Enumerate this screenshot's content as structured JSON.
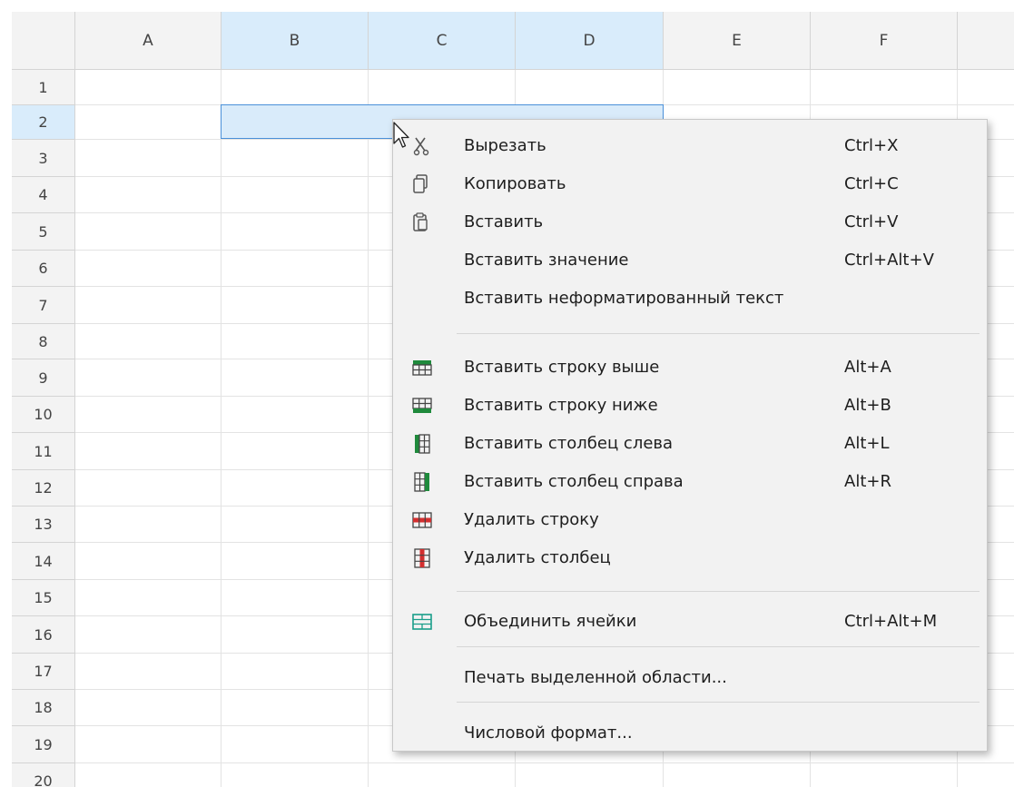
{
  "sheet": {
    "columns": [
      "A",
      "B",
      "C",
      "D",
      "E",
      "F"
    ],
    "selected_columns": [
      "B",
      "C",
      "D"
    ],
    "rows": [
      "1",
      "2",
      "3",
      "4",
      "5",
      "6",
      "7",
      "8",
      "9",
      "10",
      "11",
      "12",
      "13",
      "14",
      "15",
      "16",
      "17",
      "18",
      "19",
      "20"
    ],
    "selected_row": "2",
    "selection_color": "#d9ebfa",
    "selection_border_color": "#4a90d9"
  },
  "context_menu": {
    "items": [
      {
        "label": "Вырезать",
        "shortcut": "Ctrl+X",
        "icon": "scissors-icon"
      },
      {
        "label": "Копировать",
        "shortcut": "Ctrl+C",
        "icon": "copy-icon"
      },
      {
        "label": "Вставить",
        "shortcut": "Ctrl+V",
        "icon": "paste-icon"
      },
      {
        "label": "Вставить значение",
        "shortcut": "Ctrl+Alt+V",
        "icon": ""
      },
      {
        "label": "Вставить неформатированный текст",
        "shortcut": "",
        "icon": ""
      },
      {
        "label": "Вставить строку выше",
        "shortcut": "Alt+A",
        "icon": "insert-row-above-icon"
      },
      {
        "label": "Вставить строку ниже",
        "shortcut": "Alt+B",
        "icon": "insert-row-below-icon"
      },
      {
        "label": "Вставить столбец слева",
        "shortcut": "Alt+L",
        "icon": "insert-column-left-icon"
      },
      {
        "label": "Вставить столбец справа",
        "shortcut": "Alt+R",
        "icon": "insert-column-right-icon"
      },
      {
        "label": "Удалить строку",
        "shortcut": "",
        "icon": "delete-row-icon"
      },
      {
        "label": "Удалить столбец",
        "shortcut": "",
        "icon": "delete-column-icon"
      },
      {
        "label": "Объединить ячейки",
        "shortcut": "Ctrl+Alt+M",
        "icon": "merge-cells-icon"
      },
      {
        "label": "Печать выделенной области...",
        "shortcut": "",
        "icon": ""
      },
      {
        "label": "Числовой формат...",
        "shortcut": "",
        "icon": ""
      }
    ],
    "colors": {
      "green": "#1f8a3c",
      "red": "#d32f2f",
      "teal": "#1a9e8a"
    }
  }
}
